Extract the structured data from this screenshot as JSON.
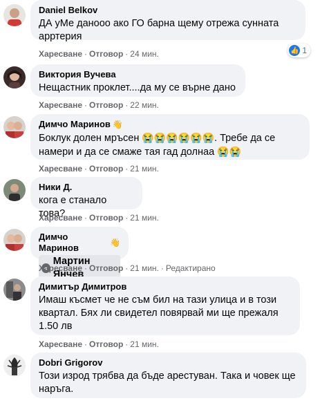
{
  "labels": {
    "like": "Харесване",
    "reply": "Отговор",
    "edited": "Редактирано",
    "dot": "·"
  },
  "comments": [
    {
      "author": "Daniel Belkov",
      "text": "ДА уМе данооо ако ГО барна щему отрежа сунната арртерия",
      "time": "24 мин.",
      "reactions": {
        "icon": "like-icon",
        "count": "1"
      }
    },
    {
      "author": "Виктория Вучева",
      "text": "Нещастник проклет....да му се върне дано",
      "time": "22 мин."
    },
    {
      "author": "Димчо Маринов",
      "badge": "wave-icon",
      "text_before": "Боклук долен мръсен",
      "emojis": [
        "😭",
        "😭",
        "😭",
        "😭",
        "😭",
        "😭"
      ],
      "text_after": ". Требе да се намери и да се смаже тая гад долнаа",
      "emojis_end": [
        "😭",
        "😭"
      ],
      "time": "21 мин."
    },
    {
      "author": "Ники Д.",
      "text": "кога е станало това?",
      "time": "21 мин."
    },
    {
      "author": "Димчо Маринов",
      "badge": "wave-icon",
      "mention": "Мартин Янчев",
      "text_after": ".",
      "time": "21 мин.",
      "edited": true
    },
    {
      "author": "Димитър Димитров",
      "text": "Имаш късмет че не съм бил на тази улица и в този квартал. Бях ли свидетел повярвай ми ще прежаля 1.50 лв",
      "time": "21 мин."
    },
    {
      "author": "Dobri Grigorov",
      "text": "Този изрод трябва да бъде арестуван. Така и човек ще наръга."
    }
  ]
}
